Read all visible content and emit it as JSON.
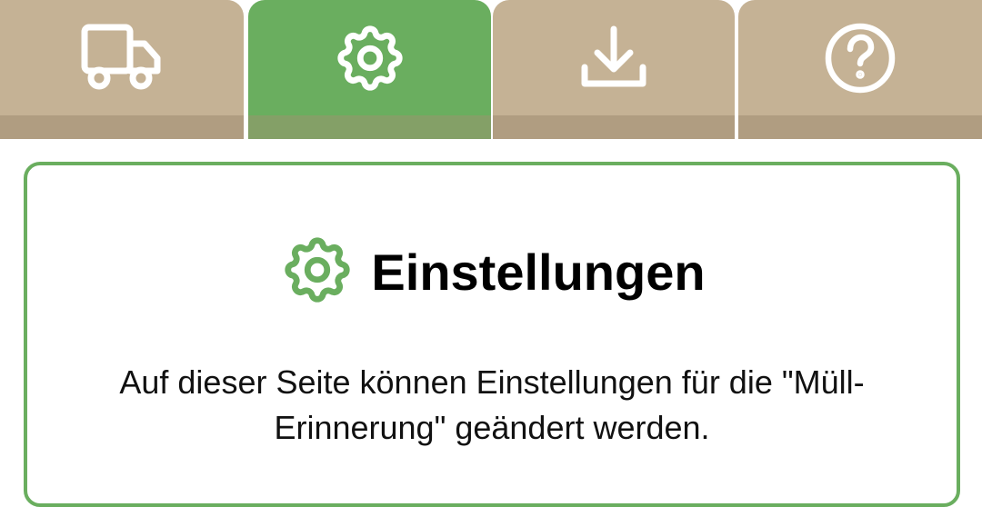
{
  "tabs": [
    {
      "id": "transport",
      "icon": "truck-icon",
      "active": false
    },
    {
      "id": "settings",
      "icon": "gear-icon",
      "active": true
    },
    {
      "id": "download",
      "icon": "download-icon",
      "active": false
    },
    {
      "id": "help",
      "icon": "help-circle-icon",
      "active": false
    }
  ],
  "colors": {
    "tab_face": "#c5b295",
    "tab_lip": "#b09d81",
    "tab_active_face": "#6aae5f",
    "tab_active_lip": "#84a067",
    "icon_on_tab": "#ffffff",
    "accent": "#6aae5f",
    "text": "#000000"
  },
  "card": {
    "title": "Einstellungen",
    "title_icon": "gear-icon",
    "description": "Auf dieser Seite können Einstellungen für die \"Müll-Erinnerung\" geändert werden."
  }
}
